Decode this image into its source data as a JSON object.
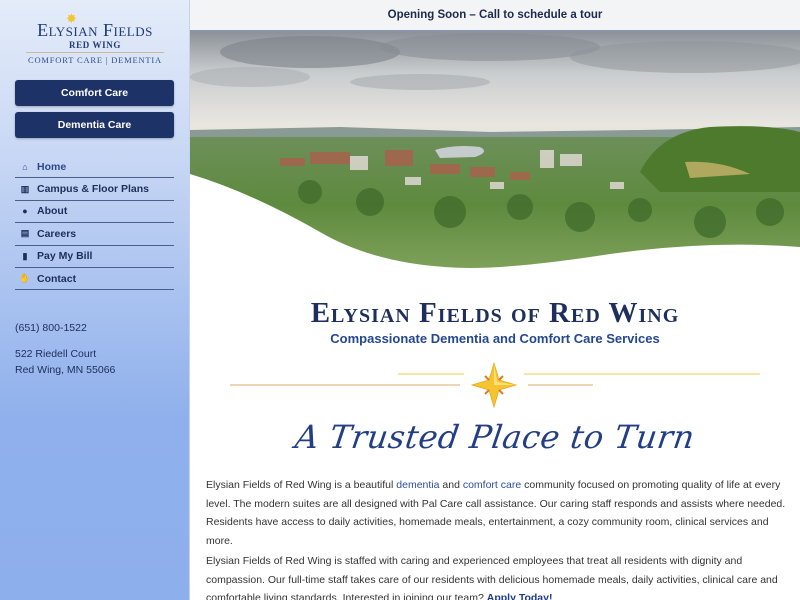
{
  "logo": {
    "name": "Elysian Fields",
    "location": "Red Wing",
    "tagline": "Comfort Care | Dementia"
  },
  "sidebar": {
    "buttons": [
      {
        "label": "Comfort Care"
      },
      {
        "label": "Dementia Care"
      }
    ],
    "nav": [
      {
        "label": "Home",
        "icon": "home-icon",
        "glyph": "⌂",
        "active": true
      },
      {
        "label": "Campus & Floor Plans",
        "icon": "map-icon",
        "glyph": "▥",
        "active": false
      },
      {
        "label": "About",
        "icon": "info-circle-icon",
        "glyph": "●",
        "active": false
      },
      {
        "label": "Careers",
        "icon": "briefcase-icon",
        "glyph": "▤",
        "active": false
      },
      {
        "label": "Pay My Bill",
        "icon": "file-invoice-icon",
        "glyph": "▮",
        "active": false
      },
      {
        "label": "Contact",
        "icon": "handshake-icon",
        "glyph": "✋",
        "active": false
      }
    ],
    "contact": {
      "phone": "(651) 800-1522",
      "address_line1": "522 Riedell Court",
      "address_line2": "Red Wing, MN 55066"
    }
  },
  "topbar": {
    "announcement": "Opening Soon – Call to schedule a tour"
  },
  "hero": {
    "image_description": "aerial view of Red Wing town with river and bluffs"
  },
  "main": {
    "title": "Elysian Fields of Red Wing",
    "subtitle": "Compassionate Dementia and Comfort Care Services",
    "script_heading": "A Trusted Place to Turn",
    "paragraph1": {
      "before": "Elysian Fields of Red Wing is a beautiful ",
      "link1": "dementia",
      "middle": " and ",
      "link2": "comfort care",
      "after": " community focused on promoting quality of life at every level. The modern suites are all designed with Pal Care call assistance. Our caring staff responds and assists where needed. Residents have access to daily activities, homemade meals, entertainment, a cozy community room, clinical services and more."
    },
    "paragraph2": {
      "text": "Elysian Fields of Red Wing is staffed with caring and experienced employees that treat all residents with dignity and compassion. Our full-time staff takes care of our residents with delicious homemade meals, daily activities, clinical care and comfortable living standards. Interested in joining our team? ",
      "link": "Apply Today!"
    }
  },
  "colors": {
    "navy": "#1d3266",
    "link": "#2e4f98",
    "gold": "#f3c531",
    "accent_orange": "#e07a2e"
  }
}
